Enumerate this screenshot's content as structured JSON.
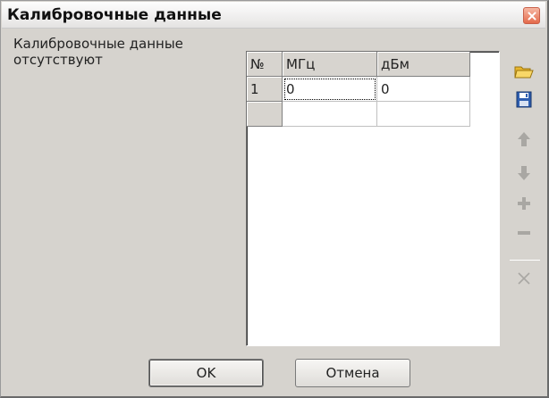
{
  "window": {
    "title": "Калибровочные данные"
  },
  "message": {
    "line1": "Калибровочные данные",
    "line2": "отсутствуют"
  },
  "table": {
    "columns": [
      "№",
      "МГц",
      "дБм"
    ],
    "rows": [
      [
        "1",
        "0",
        "0"
      ],
      [
        "",
        "",
        ""
      ]
    ]
  },
  "toolbar": {
    "icons": [
      "open-folder-icon",
      "save-disk-icon",
      "arrow-up-icon",
      "arrow-down-icon",
      "plus-icon",
      "minus-icon",
      "clear-x-icon"
    ],
    "colors": {
      "folder": "#f5c542",
      "save": "#2f5fb0",
      "disabled": "#a9a7a3"
    }
  },
  "buttons": {
    "ok_label": "OK",
    "cancel_label": "Отмена"
  }
}
